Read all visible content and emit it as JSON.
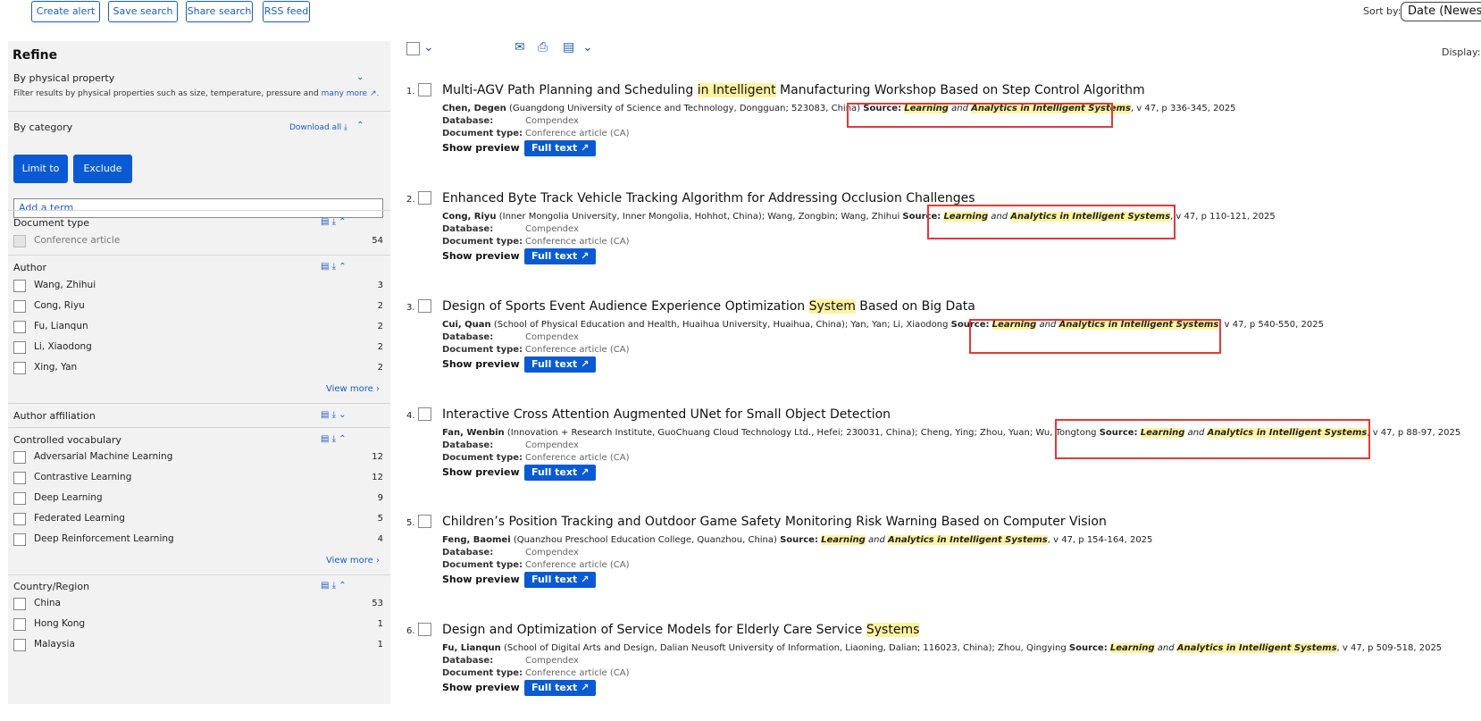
{
  "topbar": {
    "create_alert": "Create alert",
    "save_search": "Save search",
    "share_search": "Share search",
    "rss_feed": "RSS feed",
    "sort_label": "Sort by:",
    "sort_value": "Date (Newest)"
  },
  "sidebar": {
    "title": "Refine",
    "physical": {
      "title": "By physical property",
      "desc": "Filter results by physical properties such as size, temperature, pressure and",
      "more": "many more ↗."
    },
    "category": {
      "title": "By category",
      "download_all": "Download all"
    },
    "limit_to": "Limit to",
    "exclude": "Exclude",
    "add_term_placeholder": "Add a term",
    "document_type": {
      "title": "Document type",
      "items": [
        {
          "label": "Conference article",
          "count": "54"
        }
      ]
    },
    "author": {
      "title": "Author",
      "items": [
        {
          "label": "Wang, Zhihui",
          "count": "3"
        },
        {
          "label": "Cong, Riyu",
          "count": "2"
        },
        {
          "label": "Fu, Lianqun",
          "count": "2"
        },
        {
          "label": "Li, Xiaodong",
          "count": "2"
        },
        {
          "label": "Xing, Yan",
          "count": "2"
        }
      ],
      "view_more": "View more"
    },
    "affiliation": {
      "title": "Author affiliation"
    },
    "controlled_vocab": {
      "title": "Controlled vocabulary",
      "items": [
        {
          "label": "Adversarial Machine Learning",
          "count": "12"
        },
        {
          "label": "Contrastive Learning",
          "count": "12"
        },
        {
          "label": "Deep Learning",
          "count": "9"
        },
        {
          "label": "Federated Learning",
          "count": "5"
        },
        {
          "label": "Deep Reinforcement Learning",
          "count": "4"
        }
      ],
      "view_more": "View more"
    },
    "country": {
      "title": "Country/Region",
      "items": [
        {
          "label": "China",
          "count": "53"
        },
        {
          "label": "Hong Kong",
          "count": "1"
        },
        {
          "label": "Malaysia",
          "count": "1"
        }
      ]
    }
  },
  "toolbar": {
    "display_label": "Display:"
  },
  "labels": {
    "database": "Database:",
    "doctype": "Document type:",
    "show_preview": "Show preview",
    "full_text": "Full text",
    "source": "Source:"
  },
  "results": [
    {
      "num": "1.",
      "title_parts": [
        "Multi-AGV Path Planning and Scheduling ",
        "in Intelligent",
        " Manufacturing Workshop Based on Step Control Algorithm"
      ],
      "authors_bold": "Chen, Degen",
      "authors_rest": " (Guangdong University of Science and Technology, Dongguan; 523083, China) ",
      "source_learning": "Learning",
      "source_and": " and ",
      "source_rest": "Analytics in Intelligent Systems",
      "tail": ", v 47, p 336-345, 2025",
      "database": "Compendex",
      "doctype": "Conference article (CA)"
    },
    {
      "num": "2.",
      "title_parts": [
        "Enhanced Byte Track Vehicle Tracking Algorithm for Addressing Occlusion Challenges",
        "",
        ""
      ],
      "authors_bold": "Cong, Riyu",
      "authors_rest": " (Inner Mongolia University, Inner Mongolia, Hohhot, China); Wang, Zongbin; Wang, Zhihui ",
      "source_learning": "Learning",
      "source_and": " and ",
      "source_rest": "Analytics in Intelligent Systems",
      "tail": ", v 47, p 110-121, 2025",
      "database": "Compendex",
      "doctype": "Conference article (CA)"
    },
    {
      "num": "3.",
      "title_parts": [
        "Design of Sports Event Audience Experience Optimization ",
        "System",
        " Based on Big Data"
      ],
      "authors_bold": "Cui, Quan",
      "authors_rest": " (School of Physical Education and Health, Huaihua University, Huaihua, China); Yan, Yan; Li, Xiaodong ",
      "source_learning": "Learning",
      "source_and": " and ",
      "source_rest": "Analytics in Intelligent Systems",
      "tail": ", v 47, p 540-550, 2025",
      "database": "Compendex",
      "doctype": "Conference article (CA)"
    },
    {
      "num": "4.",
      "title_parts": [
        "Interactive Cross Attention Augmented UNet for Small Object Detection",
        "",
        ""
      ],
      "authors_bold": "Fan, Wenbin",
      "authors_rest": " (Innovation + Research Institute, GuoChuang Cloud Technology Ltd., Hefei; 230031, China); Cheng, Ying; Zhou, Yuan; Wu, Tongtong ",
      "source_learning": "Learning",
      "source_and": " and ",
      "source_rest": "Analytics in Intelligent Systems",
      "tail": ", v 47, p 88-97, 2025",
      "database": "Compendex",
      "doctype": "Conference article (CA)"
    },
    {
      "num": "5.",
      "title_parts": [
        "Children’s Position Tracking and Outdoor Game Safety Monitoring Risk Warning Based on Computer Vision",
        "",
        ""
      ],
      "authors_bold": "Feng, Baomei",
      "authors_rest": " (Quanzhou Preschool Education College, Quanzhou, China) ",
      "source_learning": "Learning",
      "source_and": " and ",
      "source_rest": "Analytics in Intelligent Systems",
      "tail": ", v 47, p 154-164, 2025",
      "database": "Compendex",
      "doctype": "Conference article (CA)"
    },
    {
      "num": "6.",
      "title_parts": [
        "Design and Optimization of Service Models for Elderly Care Service ",
        "Systems",
        ""
      ],
      "authors_bold": "Fu, Lianqun",
      "authors_rest": " (School of Digital Arts and Design, Dalian Neusoft University of Information, Liaoning, Dalian; 116023, China); Zhou, Qingying ",
      "source_learning": "Learning",
      "source_and": " and ",
      "source_rest": "Analytics in Intelligent Systems",
      "tail": ", v 47, p 509-518, 2025",
      "database": "Compendex",
      "doctype": "Conference article (CA)"
    }
  ]
}
